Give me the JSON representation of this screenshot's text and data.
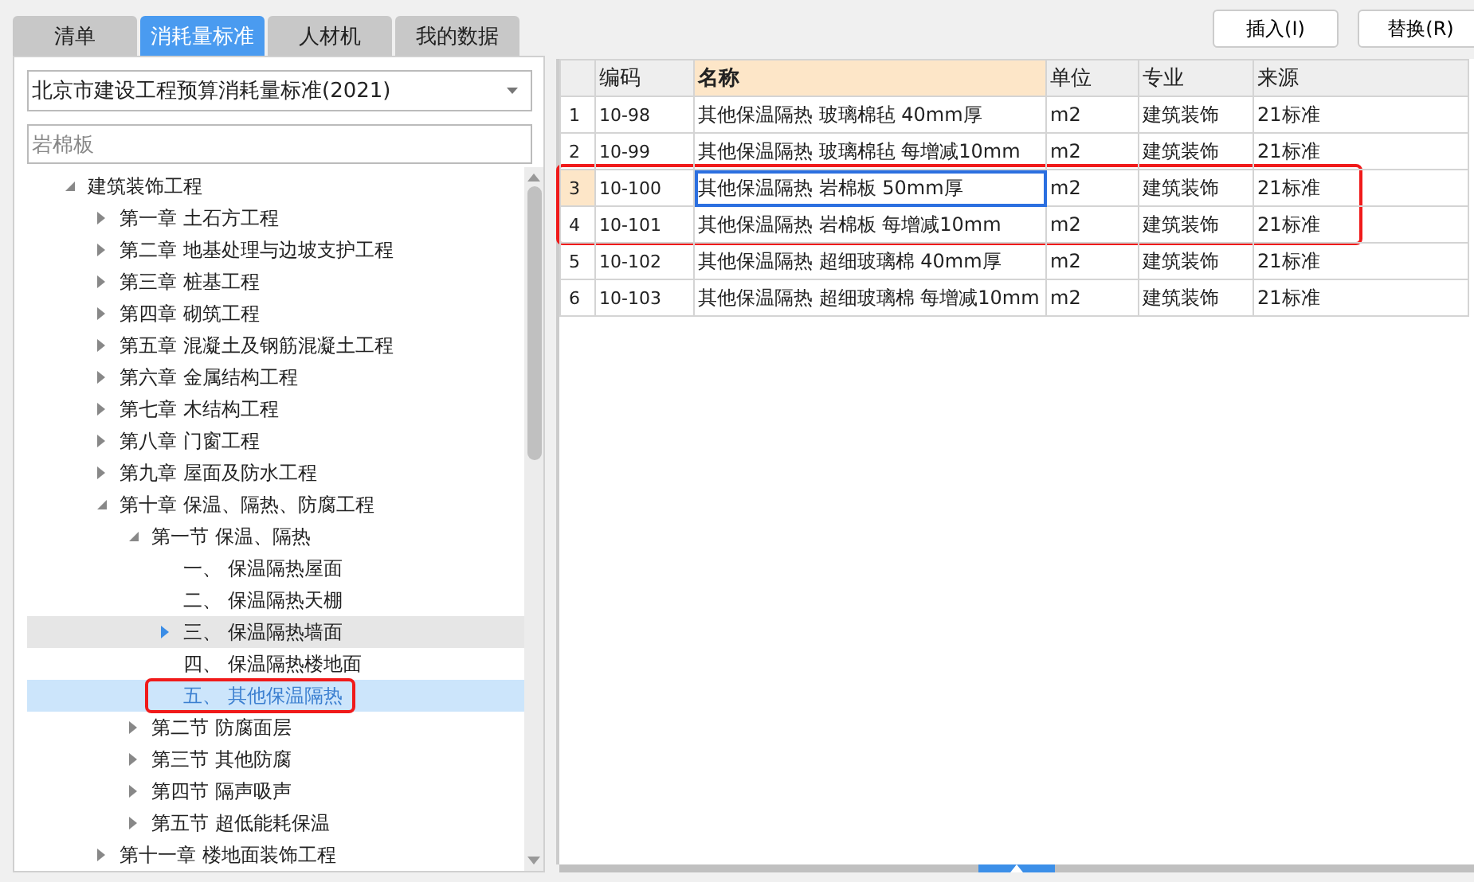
{
  "tabs": [
    {
      "label": "清单",
      "selected": false
    },
    {
      "label": "消耗量标准",
      "selected": true
    },
    {
      "label": "人材机",
      "selected": false
    },
    {
      "label": "我的数据",
      "selected": false
    }
  ],
  "standard_select": {
    "value": "北京市建设工程预算消耗量标准(2021)"
  },
  "search": {
    "value": "岩棉板"
  },
  "tree": [
    {
      "label": "建筑装饰工程",
      "expanded": true,
      "selected": false,
      "highlighted": false,
      "children": [
        {
          "label": "第一章 土石方工程",
          "expanded": false,
          "selected": false,
          "highlighted": false
        },
        {
          "label": "第二章 地基处理与边坡支护工程",
          "expanded": false,
          "selected": false,
          "highlighted": false
        },
        {
          "label": "第三章 桩基工程",
          "expanded": false,
          "selected": false,
          "highlighted": false
        },
        {
          "label": "第四章 砌筑工程",
          "expanded": false,
          "selected": false,
          "highlighted": false
        },
        {
          "label": "第五章 混凝土及钢筋混凝土工程",
          "expanded": false,
          "selected": false,
          "highlighted": false
        },
        {
          "label": "第六章 金属结构工程",
          "expanded": false,
          "selected": false,
          "highlighted": false
        },
        {
          "label": "第七章 木结构工程",
          "expanded": false,
          "selected": false,
          "highlighted": false
        },
        {
          "label": "第八章 门窗工程",
          "expanded": false,
          "selected": false,
          "highlighted": false
        },
        {
          "label": "第九章 屋面及防水工程",
          "expanded": false,
          "selected": false,
          "highlighted": false
        },
        {
          "label": "第十章 保温、隔热、防腐工程",
          "expanded": true,
          "selected": false,
          "highlighted": false,
          "children": [
            {
              "label": "第一节 保温、隔热",
              "expanded": true,
              "selected": false,
              "highlighted": false,
              "children": [
                {
                  "label": "一、 保温隔热屋面",
                  "selected": false,
                  "highlighted": false
                },
                {
                  "label": "二、 保温隔热天棚",
                  "selected": false,
                  "highlighted": false
                },
                {
                  "label": "三、 保温隔热墙面",
                  "expanded": false,
                  "selected": false,
                  "highlighted": true
                },
                {
                  "label": "四、 保温隔热楼地面",
                  "selected": false,
                  "highlighted": false
                },
                {
                  "label": "五、 其他保温隔热",
                  "selected": true,
                  "highlighted": false
                }
              ]
            },
            {
              "label": "第二节 防腐面层",
              "expanded": false,
              "selected": false,
              "highlighted": false
            },
            {
              "label": "第三节 其他防腐",
              "expanded": false,
              "selected": false,
              "highlighted": false
            },
            {
              "label": "第四节 隔声吸声",
              "expanded": false,
              "selected": false,
              "highlighted": false
            },
            {
              "label": "第五节 超低能耗保温",
              "expanded": false,
              "selected": false,
              "highlighted": false
            }
          ]
        },
        {
          "label": "第十一章 楼地面装饰工程",
          "expanded": false,
          "selected": false,
          "highlighted": false
        }
      ]
    }
  ],
  "buttons": [
    "插入(I)",
    "替换(R)"
  ],
  "table": {
    "columns": [
      {
        "label": "编码",
        "selected": false
      },
      {
        "label": "名称",
        "selected": true
      },
      {
        "label": "单位",
        "selected": false
      },
      {
        "label": "专业",
        "selected": false
      },
      {
        "label": "来源",
        "selected": false
      }
    ],
    "rows": [
      {
        "index": "1",
        "selected": false,
        "cells": [
          "10-98",
          "其他保温隔热 玻璃棉毡 40mm厚",
          "m2",
          "建筑装饰",
          "21标准"
        ]
      },
      {
        "index": "2",
        "selected": false,
        "cells": [
          "10-99",
          "其他保温隔热 玻璃棉毡 每增减10mm",
          "m2",
          "建筑装饰",
          "21标准"
        ]
      },
      {
        "index": "3",
        "selected": true,
        "cells": [
          "10-100",
          "其他保温隔热 岩棉板 50mm厚",
          "m2",
          "建筑装饰",
          "21标准"
        ]
      },
      {
        "index": "4",
        "selected": false,
        "cells": [
          "10-101",
          "其他保温隔热 岩棉板 每增减10mm",
          "m2",
          "建筑装饰",
          "21标准"
        ]
      },
      {
        "index": "5",
        "selected": false,
        "cells": [
          "10-102",
          "其他保温隔热 超细玻璃棉 40mm厚",
          "m2",
          "建筑装饰",
          "21标准"
        ]
      },
      {
        "index": "6",
        "selected": false,
        "cells": [
          "10-103",
          "其他保温隔热 超细玻璃棉 每增减10mm",
          "m2",
          "建筑装饰",
          "21标准"
        ]
      }
    ]
  }
}
